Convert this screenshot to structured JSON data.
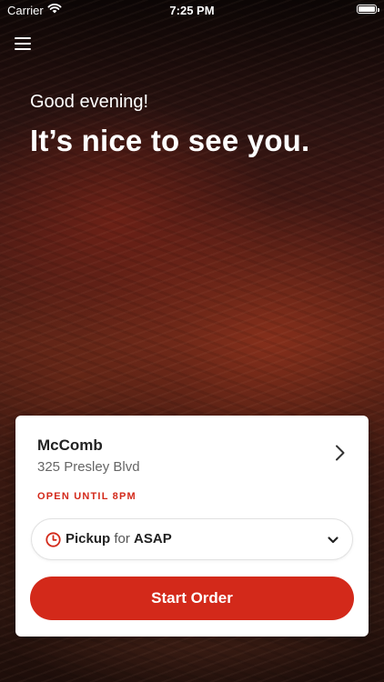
{
  "status_bar": {
    "carrier": "Carrier",
    "time": "7:25 PM",
    "wifi_icon": "wifi-icon",
    "battery_icon": "battery-icon",
    "battery_level": 1.0
  },
  "nav": {
    "menu_icon": "hamburger-menu-icon"
  },
  "hero": {
    "greeting": "Good evening!",
    "headline": "It’s nice to see you."
  },
  "store_card": {
    "store_name": "McComb",
    "address": "325 Presley Blvd",
    "open_status": "OPEN UNTIL 8PM",
    "chevron_icon": "chevron-right-icon",
    "order_mode": {
      "clock_icon": "clock-icon",
      "mode": "Pickup",
      "connector": "for",
      "timing": "ASAP",
      "dropdown_icon": "chevron-down-icon"
    },
    "start_order_label": "Start Order"
  },
  "colors": {
    "accent": "#d3291a",
    "card_bg": "#ffffff",
    "text_primary": "#222222",
    "text_secondary": "#666666"
  }
}
